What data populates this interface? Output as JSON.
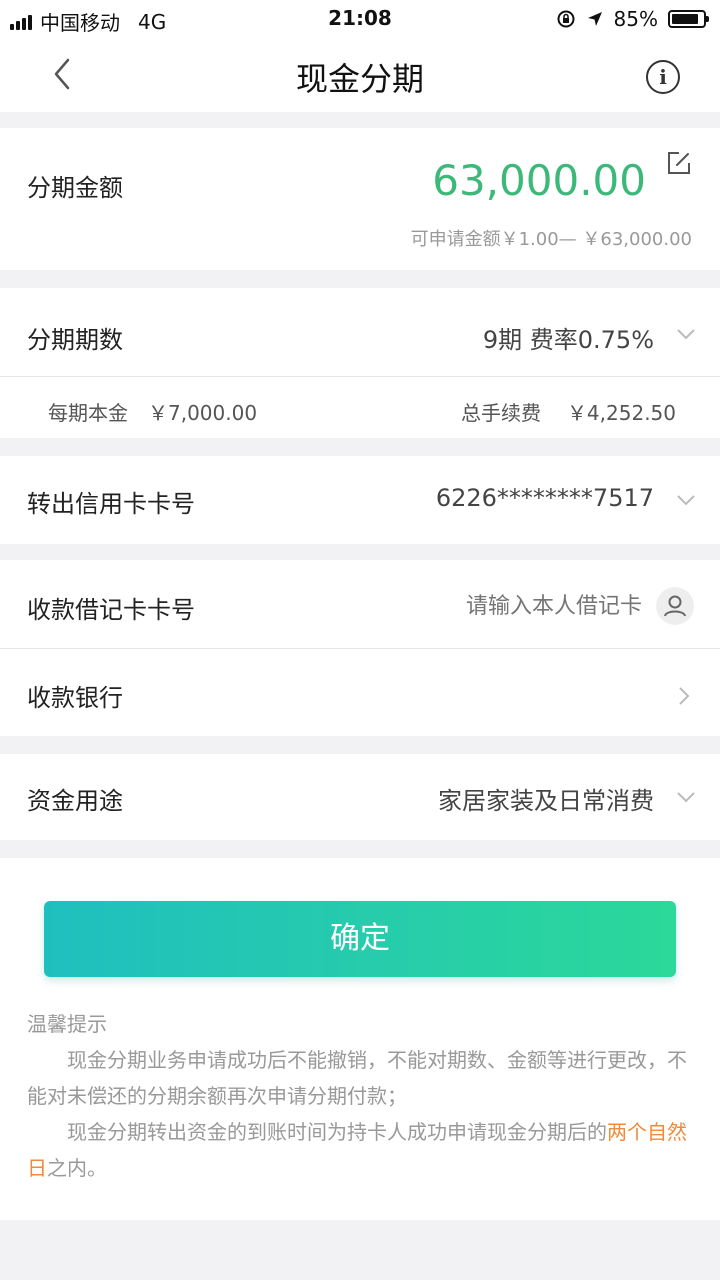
{
  "status_bar": {
    "carrier": "中国移动",
    "network": "4G",
    "time": "21:08",
    "battery": "85%",
    "battery_level": 0.85
  },
  "nav": {
    "title": "现金分期",
    "back_icon": "chevron-left-icon",
    "info_icon": "info-icon",
    "info_glyph": "i"
  },
  "amount_section": {
    "label": "分期金额",
    "value": "63,000.00",
    "range": "可申请金额￥1.00— ￥63,000.00",
    "value_color": "#3cb878"
  },
  "installment": {
    "label": "分期期数",
    "value": "9期 费率0.75%",
    "principal_label": "每期本金",
    "principal_value": "￥7,000.00",
    "fee_label": "总手续费",
    "fee_value": "￥4,252.50"
  },
  "credit_card": {
    "label": "转出信用卡卡号",
    "value": "6226********7517"
  },
  "debit_card": {
    "label": "收款借记卡卡号",
    "placeholder": "请输入本人借记卡"
  },
  "bank": {
    "label": "收款银行"
  },
  "purpose": {
    "label": "资金用途",
    "value": "家居家装及日常消费"
  },
  "confirm_button": "确定",
  "tips": {
    "title": "温馨提示",
    "line1": "现金分期业务申请成功后不能撤销，不能对期数、金额等进行更改，不能对未偿还的分期余额再次申请分期付款；",
    "line2_prefix": "现金分期转出资金的到账时间为持卡人成功申请现金分期后的",
    "line2_highlight": "两个自然日",
    "line2_suffix": "之内。"
  },
  "colors": {
    "accent_green": "#3cb878",
    "highlight_orange": "#f08a3c",
    "button_gradient_start": "#1fbfbf",
    "button_gradient_end": "#2cd89a"
  }
}
